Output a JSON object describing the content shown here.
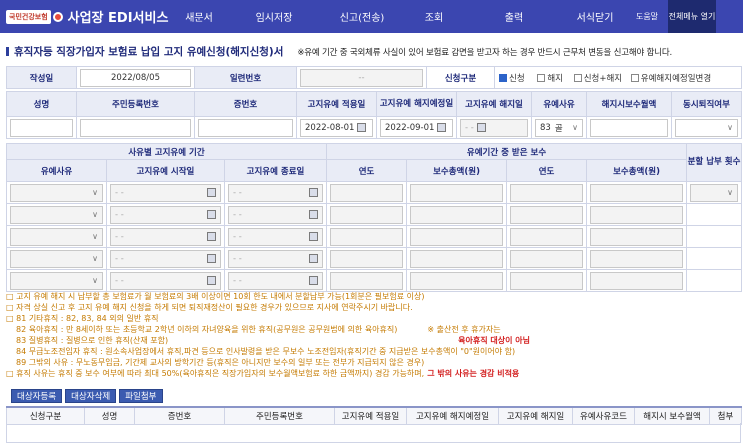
{
  "header": {
    "logo_badge": "국민건강보험",
    "app_title": "사업장 EDI서비스",
    "menu": [
      "새문서",
      "임시저장",
      "신고(전송)",
      "조회",
      "출력",
      "서식닫기"
    ],
    "help": "도움말",
    "fold_all": "전체메뉴 열기"
  },
  "title": {
    "text": "휴직자등 직장가입자 보험료 납입 고지 유예신청(해지신청)서",
    "note": "※유예 기간 중 국외체류 사실이 있어 보험료 감면을 받고자 하는 경우 반드시 근무처 변동을 신고해야 합니다."
  },
  "info": {
    "written_date_label": "작성일",
    "written_date": "2022/08/05",
    "serial_label": "일련번호",
    "serial_value": "--",
    "apply_type_label": "신청구분",
    "options": [
      {
        "label": "신청",
        "checked": true
      },
      {
        "label": "해지",
        "checked": false
      },
      {
        "label": "신청+해지",
        "checked": false
      },
      {
        "label": "유예해지예정일변경",
        "checked": false
      }
    ]
  },
  "person": {
    "headers": [
      "성명",
      "주민등록번호",
      "증번호",
      "고지유예 적용일",
      "고지유예 해지예정일",
      "고지유예 해지일",
      "유예사유",
      "해지시보수월액",
      "동시퇴직여부"
    ],
    "row": {
      "name": "",
      "rrn": "",
      "cert_no": "",
      "apply_date": "2022-08-01",
      "end_planned": "2022-09-01",
      "end_date": "- -",
      "reason_code": "83",
      "reason_text": "골",
      "salary": "",
      "retire": ""
    }
  },
  "period": {
    "group1": "사유별 고지유예 기간",
    "group2": "유예기간 중 받은 보수",
    "group3": "분할 납부 횟수",
    "headers": [
      "유예사유",
      "고지유예 시작일",
      "고지유예 종료일",
      "연도",
      "보수총액(원)",
      "연도",
      "보수총액(원)"
    ],
    "rows": [
      {
        "start": "- -",
        "end": "- -"
      },
      {
        "start": "- -",
        "end": "- -"
      },
      {
        "start": "- -",
        "end": "- -"
      },
      {
        "start": "- -",
        "end": "- -"
      },
      {
        "start": "- -",
        "end": "- -"
      }
    ]
  },
  "notes": {
    "l1": "□ 고지 유예 해지 시 납부할 총 보험료가 월 보험료의 3배 이상이면 10회 한도 내에서 분할납부 가능(1회분은 필보험료 이상)",
    "l2": "□ 자격 상실 신고 후 고지 유예 해지 신청을 하게 되면 퇴직재정산이 필요한 경우가 있으므로 지사에 연락주시기 바랍니다.",
    "l3": "□ 81 기타휴직 : 82, 83, 84 외의 일반 휴직",
    "l4": "82 육아휴직 : 만 8세이하 또는 초등학교 2학년 이하의 자녀양육을 위한 휴직(공무원은 공무원법에 의한 육아휴직)",
    "l4b": "※ 출산전 후 휴가자는",
    "l5": "83 질병휴직 : 질병으로 인한 휴직(산재 포함)",
    "l5b": "육아휴직 대상이 아님",
    "l6": "84 무급노조전임자 휴직 : 원소속사업장에서 휴직,파견 등으로 인사발령을 받은 무보수 노조전임자(휴직기간 중 지급받은 보수총액이 \"0\"원이어야 함)",
    "l7": "89 그밖의 사유 : 무노동무임금, 기간제 교사의 방학기간 등(휴직은 아니지만 보수의 일부 또는 전부가 지급되지 않은 경우)",
    "l8a": "□ 휴직 사유는 휴직 중 보수 여부에 따라 최대 50%(육아휴직은 직장가입자의 보수월액보험료 하한 금액까지) 경감 가능하며,",
    "l8b": "그 밖의 사유는 경감 비적용"
  },
  "buttons": [
    "대상자등록",
    "대상자삭제",
    "파일첨부"
  ],
  "bottom_headers": [
    "신청구분",
    "성명",
    "증번호",
    "주민등록번호",
    "고지유예 적용일",
    "고지유예 해지예정일",
    "고지유예 해지일",
    "유예사유코드",
    "해지시 보수월액",
    "첨부"
  ]
}
